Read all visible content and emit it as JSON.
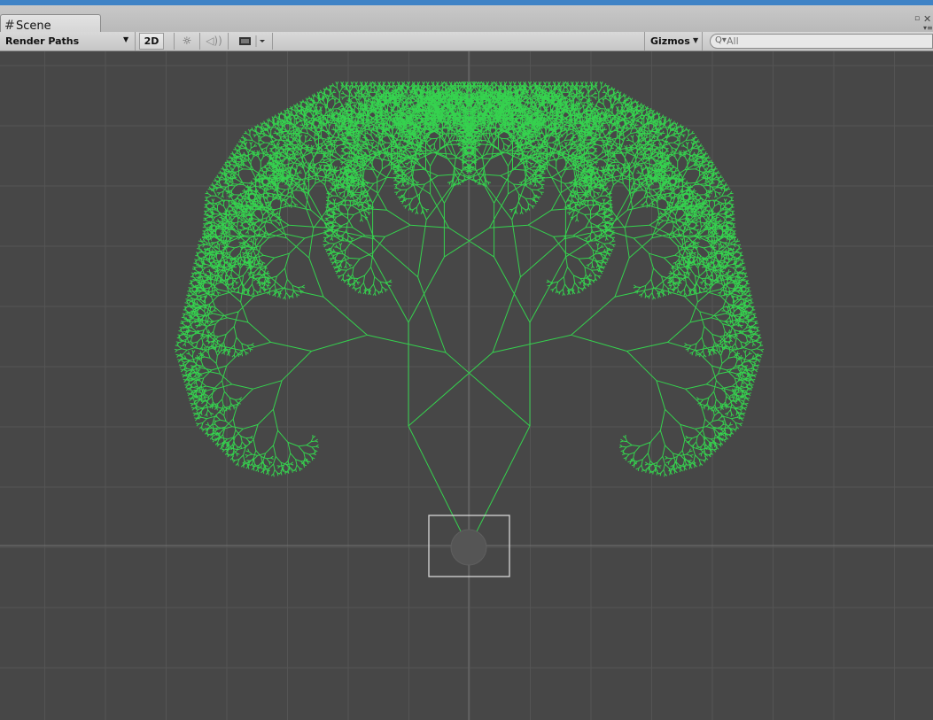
{
  "window": {
    "tab_icon": "grid-hash-icon",
    "tab_title": "Scene"
  },
  "toolbar": {
    "render_mode": "Render Paths",
    "mode_2d_label": "2D",
    "lighting_icon": "sun-icon",
    "audio_icon": "speaker-icon",
    "effects_icon": "image-icon",
    "gizmos_label": "Gizmos",
    "search_value": "All"
  },
  "scene": {
    "background_color": "#474747",
    "grid_color": "#545454",
    "axis_color": "#6a6a6a",
    "tree_color": "#35d24e",
    "selection_box_color": "#d8d8d8"
  }
}
